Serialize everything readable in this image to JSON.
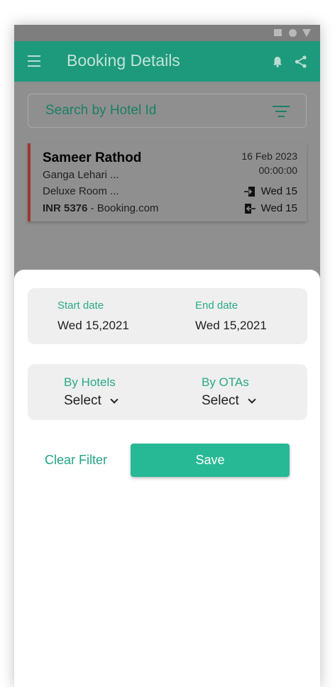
{
  "appbar": {
    "title": "Booking Details",
    "left_icon": "menu-icon",
    "right_icons": [
      "bell-icon",
      "share-icon"
    ]
  },
  "search": {
    "placeholder": "Search by Hotel Id",
    "icon": "filter-icon"
  },
  "booking": {
    "guest_name": "Sameer Rathod",
    "hotel": "Ganga Lehari ...",
    "room": "Deluxe Room ...",
    "price": "INR 5376",
    "source": " - Booking.com",
    "date": "16 Feb 2023",
    "time": "00:00:00",
    "checkin": "Wed 15",
    "checkout": "Wed 15",
    "accent_color": "#a23534"
  },
  "filter_sheet": {
    "start_label": "Start date",
    "start_value": "Wed 15,2021",
    "end_label": "End date",
    "end_value": "Wed 15,2021",
    "hotels_label": "By Hotels",
    "hotels_value": "Select",
    "otas_label": "By  OTAs",
    "otas_value": "Select",
    "clear_label": "Clear Filter",
    "save_label": "Save"
  },
  "colors": {
    "primary": "#1d9a7b",
    "accent": "#27b995",
    "label": "#2aa987"
  }
}
